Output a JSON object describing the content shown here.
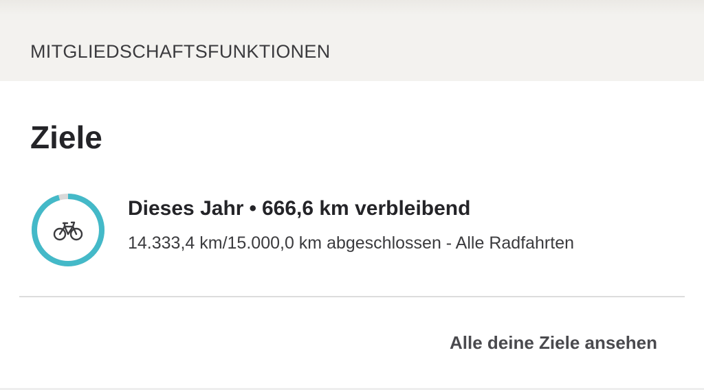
{
  "section": {
    "header_label": "MITGLIEDSCHAFTSFUNKTIONEN"
  },
  "goals_card": {
    "title": "Ziele",
    "goal": {
      "period": "Dieses Jahr",
      "separator": "•",
      "remaining": "666,6 km verbleibend",
      "detail": "14.333,4 km/15.000,0 km abgeschlossen - Alle Radfahrten",
      "progress_fraction": 0.9556,
      "icon": "bike-icon"
    },
    "all_goals_link": "Alle deine Ziele ansehen"
  },
  "colors": {
    "progress": "#44b9c8",
    "progress_track": "#d9d9d9",
    "header_background": "#f3f2ef",
    "text_primary": "#242428",
    "divider": "#dcdcdc"
  }
}
